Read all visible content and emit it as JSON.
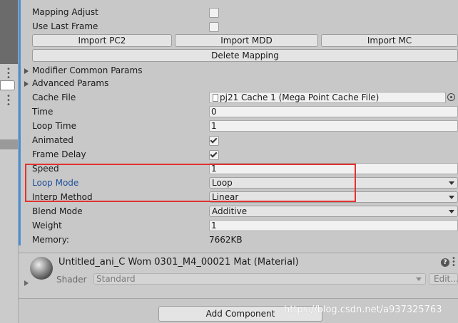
{
  "rows": {
    "mapping_adjust": "Mapping Adjust",
    "use_last_frame": "Use Last Frame",
    "modifier_common_params": "Modifier Common Params",
    "advanced_params": "Advanced Params",
    "cache_file": "Cache File",
    "time": "Time",
    "loop_time": "Loop Time",
    "animated": "Animated",
    "frame_delay": "Frame Delay",
    "speed": "Speed",
    "loop_mode": "Loop Mode",
    "interp_method": "Interp Method",
    "blend_mode": "Blend Mode",
    "weight": "Weight",
    "memory": "Memory:"
  },
  "values": {
    "mapping_adjust_checked": false,
    "use_last_frame_checked": false,
    "cache_file": "pj21 Cache 1 (Mega Point Cache File)",
    "time": "0",
    "loop_time": "1",
    "animated_checked": true,
    "frame_delay_checked": true,
    "speed": "1",
    "loop_mode": "Loop",
    "interp_method": "Linear",
    "blend_mode": "Additive",
    "weight": "1",
    "memory": "7662KB"
  },
  "buttons": {
    "import_pc2": "Import PC2",
    "import_mdd": "Import MDD",
    "import_mc": "Import MC",
    "delete_mapping": "Delete Mapping",
    "add_component": "Add Component"
  },
  "material": {
    "title": "Untitled_ani_C Wom 0301_M4_00021 Mat (Material)",
    "shader_label": "Shader",
    "shader_value": "Standard",
    "edit_label": "Edit...",
    "help_glyph": "?"
  },
  "watermark": "https://blog.csdn.net/a937325763",
  "colors": {
    "highlight_box": "#e0332f",
    "loop_mode_label": "#1f4f9a",
    "accent_bar": "#4a8fd6"
  },
  "icons": [
    "checkbox-icon",
    "checkmark-icon",
    "file-icon",
    "target-icon",
    "help-icon",
    "menu-dots-icon",
    "foldout-arrow-icon",
    "dropdown-arrow-icon",
    "material-sphere-icon"
  ]
}
